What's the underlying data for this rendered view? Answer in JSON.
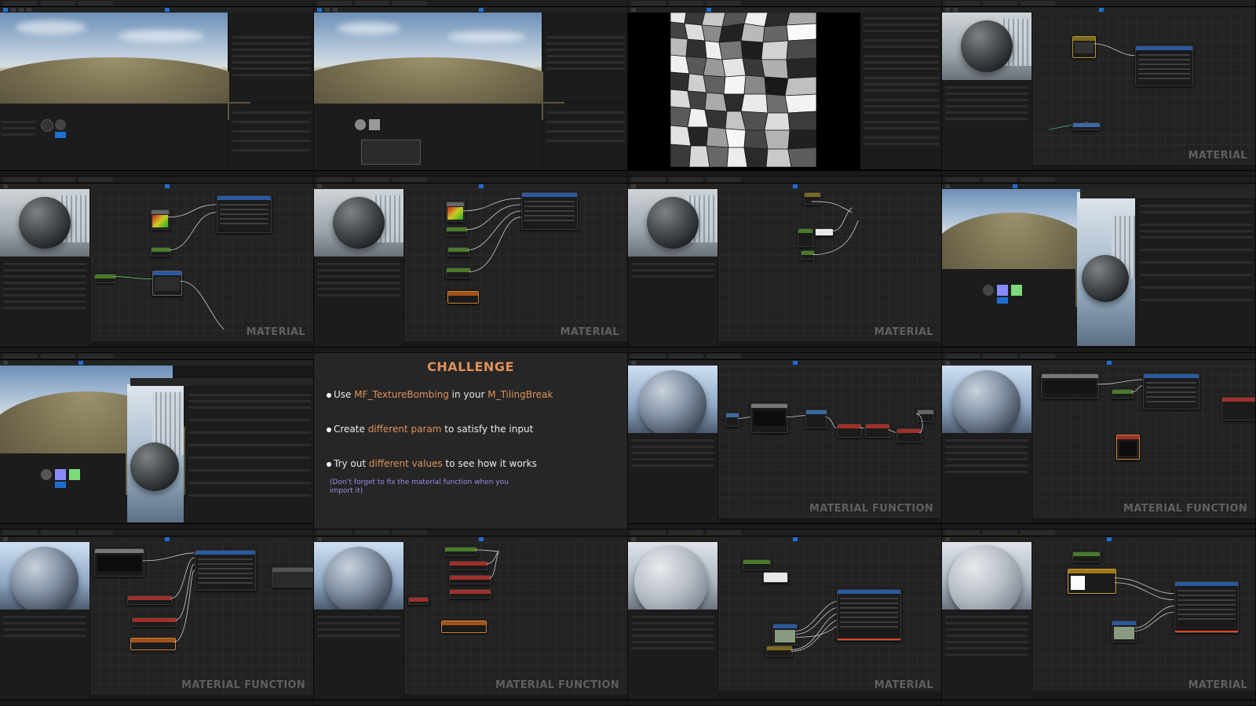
{
  "labels": {
    "material": "MATERIAL",
    "material_function": "MATERIAL FUNCTION"
  },
  "challenge": {
    "title": "CHALLENGE",
    "item1_prefix": "Use ",
    "item1_hl1": "MF_TextureBombing",
    "item1_mid": " in your ",
    "item1_hl2": "M_TilingBreak",
    "item2_prefix": "Create ",
    "item2_hl": "different param",
    "item2_suffix": " to satisfy the input",
    "item3_prefix": "Try out ",
    "item3_hl": "different values",
    "item3_suffix": " to see how it works",
    "note": "(Don’t forget to fix the material function when you import it)"
  },
  "colors": {
    "accent_orange": "#e0915a",
    "note_purple": "#9c8ae6",
    "ue_blue": "#1f6fd1"
  },
  "icons": {
    "bullet": "bullet-icon"
  }
}
